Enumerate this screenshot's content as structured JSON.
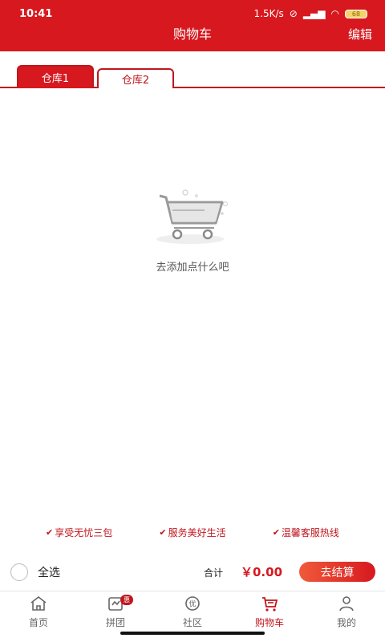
{
  "status_bar": {
    "time": "10:41",
    "speed": "1.5K/s",
    "battery": "68"
  },
  "header": {
    "title": "购物车",
    "edit_label": "编辑"
  },
  "tabs": [
    {
      "label": "仓库1",
      "active": true
    },
    {
      "label": "仓库2",
      "active": false
    }
  ],
  "empty_state": {
    "message": "去添加点什么吧"
  },
  "guarantees": [
    "享受无忧三包",
    "服务美好生活",
    "温馨客服热线"
  ],
  "checkout": {
    "select_all_label": "全选",
    "total_label": "合计",
    "total_value": "￥0.00",
    "pay_button_label": "去结算"
  },
  "tabbar": {
    "items": [
      {
        "label": "首页",
        "icon": "home-icon"
      },
      {
        "label": "拼团",
        "icon": "group-buy-icon",
        "badge": "惠"
      },
      {
        "label": "社区",
        "icon": "community-icon"
      },
      {
        "label": "购物车",
        "icon": "cart-icon",
        "active": true
      },
      {
        "label": "我的",
        "icon": "profile-icon"
      }
    ]
  },
  "colors": {
    "brand_red": "#d7181f",
    "text_red": "#c0161d"
  }
}
